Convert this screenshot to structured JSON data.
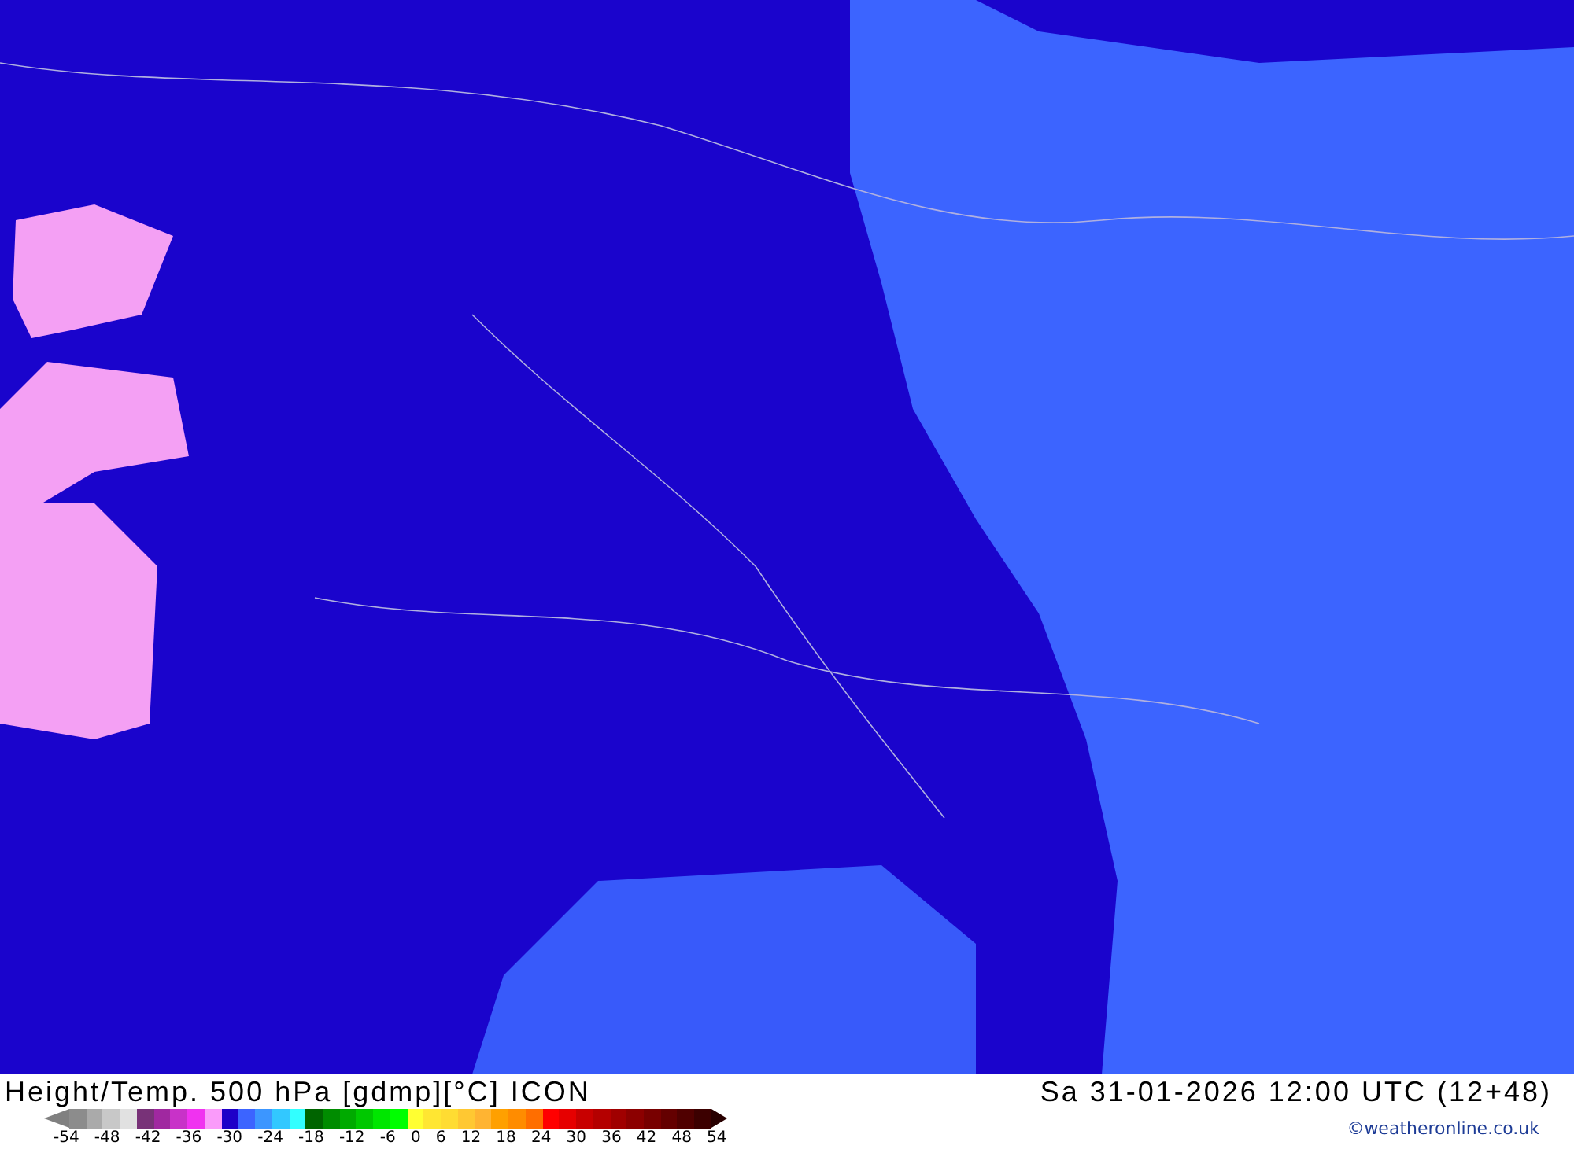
{
  "title": "Height/Temp. 500 hPa [gdmp][°C] ICON",
  "valid_time": "Sa 31-01-2026 12:00 UTC (12+48)",
  "legend": {
    "steps": [
      {
        "color": "#8c8c8c"
      },
      {
        "color": "#aaaaaa"
      },
      {
        "color": "#c8c8c8"
      },
      {
        "color": "#e1e1e1"
      },
      {
        "color": "#783278"
      },
      {
        "color": "#a028a0"
      },
      {
        "color": "#c832c8"
      },
      {
        "color": "#f032f0"
      },
      {
        "color": "#fa9bfa"
      },
      {
        "color": "#1e00c8"
      },
      {
        "color": "#3c64ff"
      },
      {
        "color": "#3c96ff"
      },
      {
        "color": "#32c8ff"
      },
      {
        "color": "#32ffff"
      },
      {
        "color": "#006400"
      },
      {
        "color": "#008c00"
      },
      {
        "color": "#00aa00"
      },
      {
        "color": "#00c800"
      },
      {
        "color": "#00e600"
      },
      {
        "color": "#00ff00"
      },
      {
        "color": "#ffff32"
      },
      {
        "color": "#ffe632"
      },
      {
        "color": "#ffdc32"
      },
      {
        "color": "#ffc832"
      },
      {
        "color": "#ffb432"
      },
      {
        "color": "#ffa000"
      },
      {
        "color": "#ff8c00"
      },
      {
        "color": "#ff6e00"
      },
      {
        "color": "#ff0000"
      },
      {
        "color": "#e60000"
      },
      {
        "color": "#c80000"
      },
      {
        "color": "#b40000"
      },
      {
        "color": "#a00000"
      },
      {
        "color": "#8c0000"
      },
      {
        "color": "#780000"
      },
      {
        "color": "#640000"
      },
      {
        "color": "#500000"
      },
      {
        "color": "#3c0000"
      }
    ],
    "ticks": [
      "-54",
      "-48",
      "-42",
      "-36",
      "-30",
      "-24",
      "-18",
      "-12",
      "-6",
      "0",
      "6",
      "12",
      "18",
      "24",
      "30",
      "36",
      "42",
      "48",
      "54"
    ]
  },
  "copyright": "©weatheronline.co.uk"
}
